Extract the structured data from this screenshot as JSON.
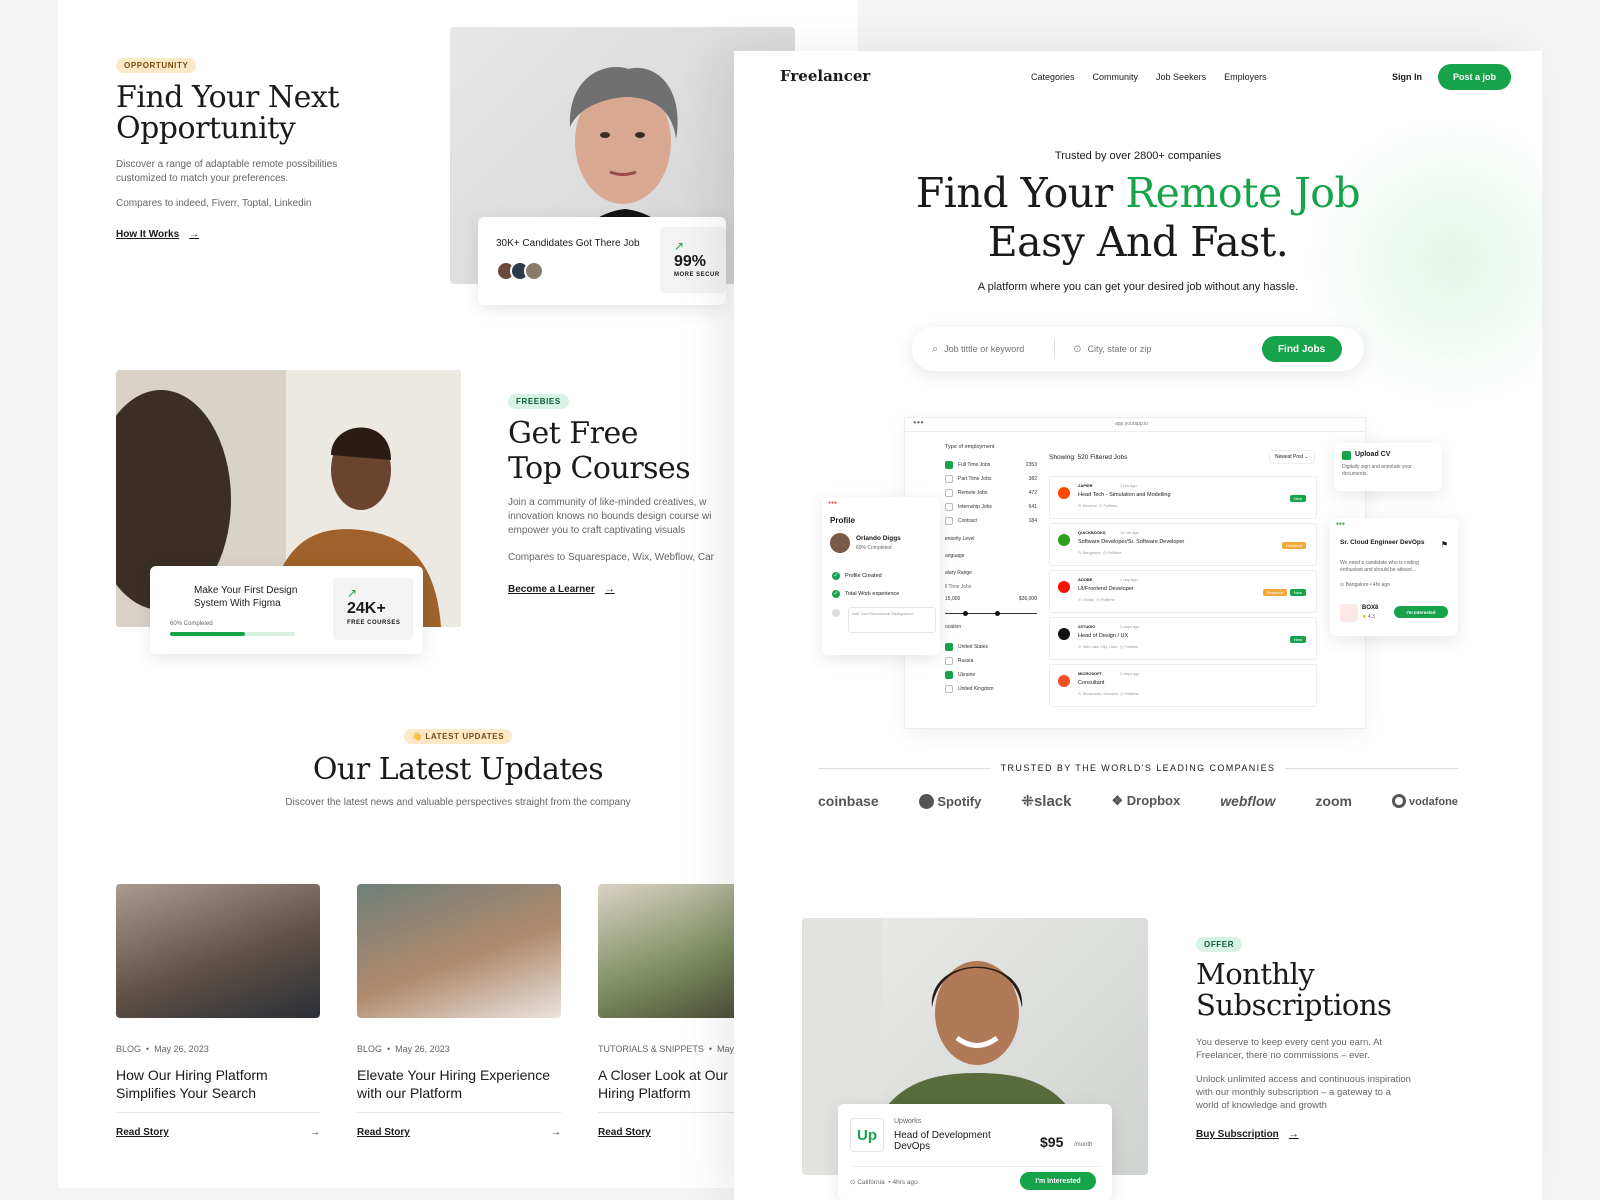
{
  "left": {
    "opportunity": {
      "badge": "OPPORTUNITY",
      "title_line1": "Find Your Next",
      "title_line2": "Opportunity",
      "desc": "Discover a range of adaptable remote possibilities customized to match your preferences.",
      "compares": "Compares to indeed, Fiverr, Toptal, Linkedin",
      "link": "How It Works",
      "stat_card": {
        "label": "30K+ Candidates Got There Job",
        "value": "99%",
        "sub": "MORE SECUR"
      }
    },
    "courses": {
      "badge": "FREEBIES",
      "title_line1": "Get Free",
      "title_line2": "Top Courses",
      "desc": "Join a community of like-minded creatives, w innovation knows no bounds design course wi empower you to craft captivating visuals",
      "compares": "Compares to Squarespace, Wix, Webflow, Car",
      "link": "Become a Learner",
      "course_card": {
        "title": "Make Your First Design System With Figma",
        "progress_label": "60% Completed",
        "progress": 0.6,
        "stat_value": "24K+",
        "stat_sub": "FREE COURSES"
      }
    },
    "updates": {
      "badge": "👋 LATEST UPDATES",
      "title": "Our Latest Updates",
      "subtitle": "Discover the latest news and valuable perspectives straight from the company",
      "posts": [
        {
          "category": "BLOG",
          "date": "May 26, 2023",
          "title": "How Our Hiring Platform Simplifies Your Search",
          "link": "Read Story"
        },
        {
          "category": "BLOG",
          "date": "May 26, 2023",
          "title": "Elevate Your Hiring Experience with our Platform",
          "link": "Read Story"
        },
        {
          "category": "TUTORIALS & SNIPPETS",
          "date": "May",
          "title": "A Closer Look at Our Hiring Platform",
          "link": "Read Story"
        }
      ]
    }
  },
  "right": {
    "nav": {
      "logo": "Freelancer",
      "links": [
        "Categories",
        "Community",
        "Job Seekers",
        "Employers"
      ],
      "signin": "Sign In",
      "post_job": "Post a job"
    },
    "hero": {
      "trusted": "Trusted by over 2800+ companies",
      "title_a": "Find Your ",
      "title_b": "Remote Job",
      "title_c": "Easy And Fast.",
      "subtitle": "A platform where you can get your desired job without any hassle.",
      "search_placeholder": "Job tittle or keyword",
      "location_placeholder": "City, state or zip",
      "find_button": "Find Jobs"
    },
    "dashboard": {
      "url": "app.yourapp.io",
      "showing": "Showing: 520 Filtered Jobs",
      "sort": "Newest Post",
      "filter_heading": "Type of employment",
      "filters": [
        {
          "label": "Full Time Jobs",
          "count": "2353",
          "checked": true
        },
        {
          "label": "Part Time Jobs",
          "count": "382",
          "checked": false
        },
        {
          "label": "Remote Jobs",
          "count": "472",
          "checked": false
        },
        {
          "label": "Internship Jobs",
          "count": "641",
          "checked": false
        },
        {
          "label": "Contract",
          "count": "184",
          "checked": false
        }
      ],
      "sections": [
        "eniority Level",
        "anguage",
        "alary Range",
        "ocation"
      ],
      "salary_sub": "ll Time Jobs",
      "salary_min": "15,000",
      "salary_max": "$36,000",
      "locations": [
        {
          "label": "United States",
          "checked": true
        },
        {
          "label": "Russia",
          "checked": false
        },
        {
          "label": "Ukraine",
          "checked": true
        },
        {
          "label": "United Kingdom",
          "checked": false
        }
      ],
      "jobs": [
        {
          "company": "ZAPIER",
          "ago": "3 hrs ago",
          "title": "Head Tech - Simulation and Modelling",
          "loc": "Mumbai",
          "type": "Fulltime",
          "tags": [
            "New"
          ],
          "logo_color": "#ff4a00"
        },
        {
          "company": "QUICKBOOKS",
          "ago": "12 hrs ago",
          "title": "Software Developer/Sr. Software Developer",
          "loc": "Bangalore",
          "type": "Fulltime",
          "tags": [
            "Featured"
          ],
          "logo_color": "#2ca01c"
        },
        {
          "company": "ADOBE",
          "ago": "1 day ago",
          "title": "UI/Frontend Developer",
          "loc": "Global",
          "type": "Fulltime",
          "tags": [
            "Featured",
            "New"
          ],
          "logo_color": "#fa0f00"
        },
        {
          "company": "2STUDIO",
          "ago": "3 days ago",
          "title": "Head of Design / UX",
          "loc": "Salt Lake City, Utah",
          "type": "Fulltime",
          "tags": [
            "New"
          ],
          "logo_color": "#111111"
        },
        {
          "company": "MICROSOFT",
          "ago": "2 days ago",
          "title": "Consultant",
          "loc": "Stockholm, Sweden",
          "type": "Fulltime",
          "tags": [],
          "logo_color": "#f25022"
        }
      ],
      "profile": {
        "heading": "Profile",
        "name": "Orlando Diggs",
        "completion": "60% Completed",
        "steps": [
          "Profile Created",
          "Total Work experience"
        ],
        "education_placeholder": "Add Your Educational Background"
      },
      "upload": {
        "title": "Upload CV",
        "desc": "Digitally sign and annotate your documents."
      },
      "job_card": {
        "title": "Sr. Cloud Engineer DevOps",
        "desc": "We need a candidate who is coding enthusiast and should be atleast...",
        "loc": "Bangalore",
        "ago": "4hr ago",
        "company": "BOX8",
        "rating": "4.3",
        "button": "I'm Interested"
      }
    },
    "companies": {
      "heading": "TRUSTED BY THE WORLD'S LEADING COMPANIES",
      "logos": [
        "coinbase",
        "Spotify",
        "slack",
        "Dropbox",
        "webflow",
        "zoom",
        "vodafone"
      ]
    },
    "offer": {
      "badge": "OFFER",
      "title_line1": "Monthly",
      "title_line2": "Subscriptions",
      "desc1": "You deserve to keep every cent you earn. At Freelancer, there no commissions – ever.",
      "desc2": "Unlock unlimited access and continuous inspiration with our monthly subscription – a gateway to a world of knowledge and growth",
      "link": "Buy Subscription",
      "card": {
        "company": "Upworks",
        "title": "Head of Development DevOps",
        "price": "$95",
        "period": "/month",
        "loc": "California",
        "ago": "4hrs ago",
        "button": "I'm Interested",
        "logo": "Up"
      }
    }
  }
}
